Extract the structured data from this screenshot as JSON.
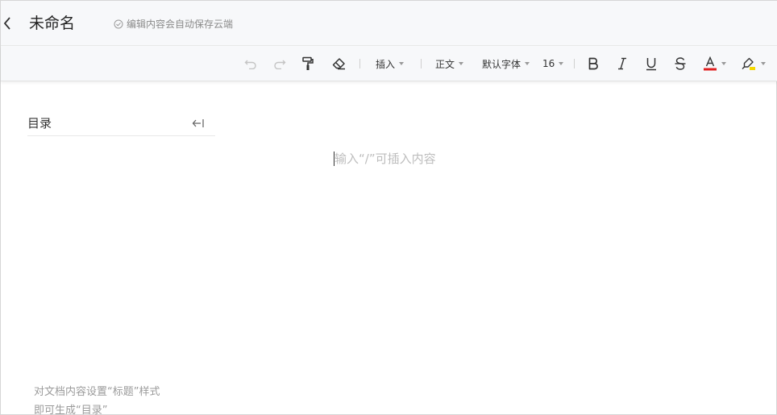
{
  "header": {
    "title": "未命名",
    "save_status": "编辑内容会自动保存云端"
  },
  "toolbar": {
    "insert_label": "插入",
    "paragraph_style": "正文",
    "font_family": "默认字体",
    "font_size": "16",
    "font_color": "#e02020",
    "highlight_color": "#f5d800"
  },
  "outline": {
    "title": "目录",
    "hint_line1": "对文档内容设置“标题”样式",
    "hint_line2": "即可生成“目录”"
  },
  "editor": {
    "placeholder": "输入“/”可插入内容"
  },
  "icons": [
    "back-icon",
    "check-circle-icon",
    "undo-icon",
    "redo-icon",
    "format-painter-icon",
    "eraser-icon",
    "bold-icon",
    "italic-icon",
    "underline-icon",
    "strikethrough-icon",
    "font-color-icon",
    "highlight-icon",
    "collapse-left-icon"
  ]
}
